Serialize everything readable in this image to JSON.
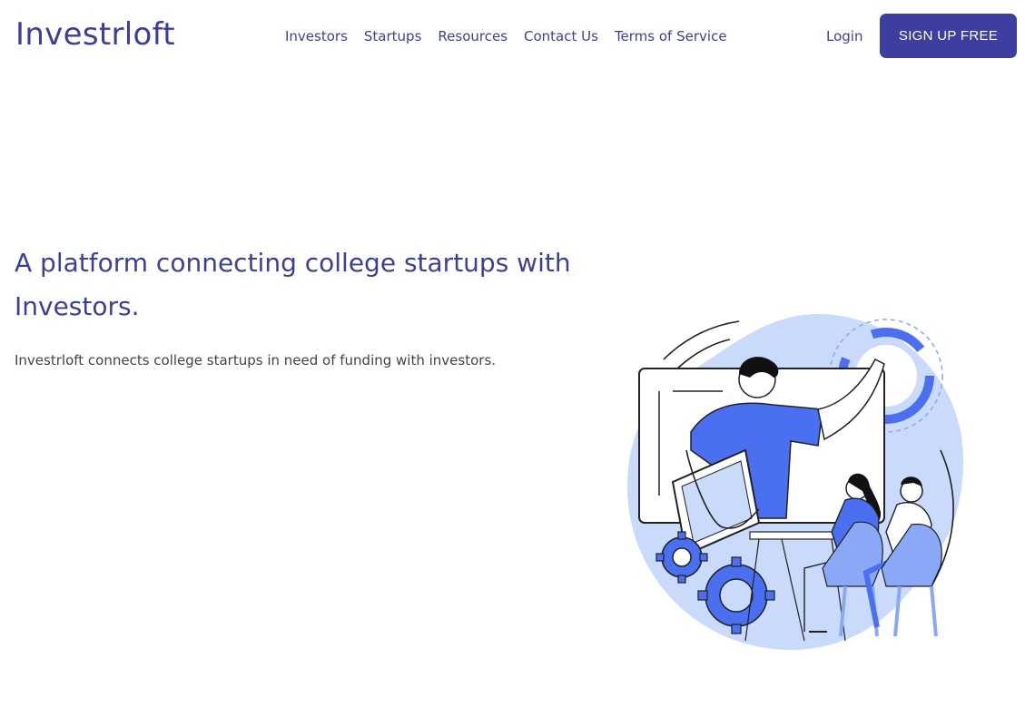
{
  "brand": {
    "name": "Investrloft",
    "primary_color": "#3d3fa0",
    "text_color": "#3b3f9a"
  },
  "nav": {
    "items": [
      {
        "label": "Investors"
      },
      {
        "label": "Startups"
      },
      {
        "label": "Resources"
      },
      {
        "label": "Contact Us"
      },
      {
        "label": "Terms of Service"
      }
    ]
  },
  "auth": {
    "login_label": "Login",
    "signup_label": "SIGN UP FREE"
  },
  "hero": {
    "headline": "A platform connecting college startups with Investors.",
    "description": "Investrloft connects college startups in need of funding with investors.",
    "illustration_icon": "team-collaboration-illustration"
  }
}
